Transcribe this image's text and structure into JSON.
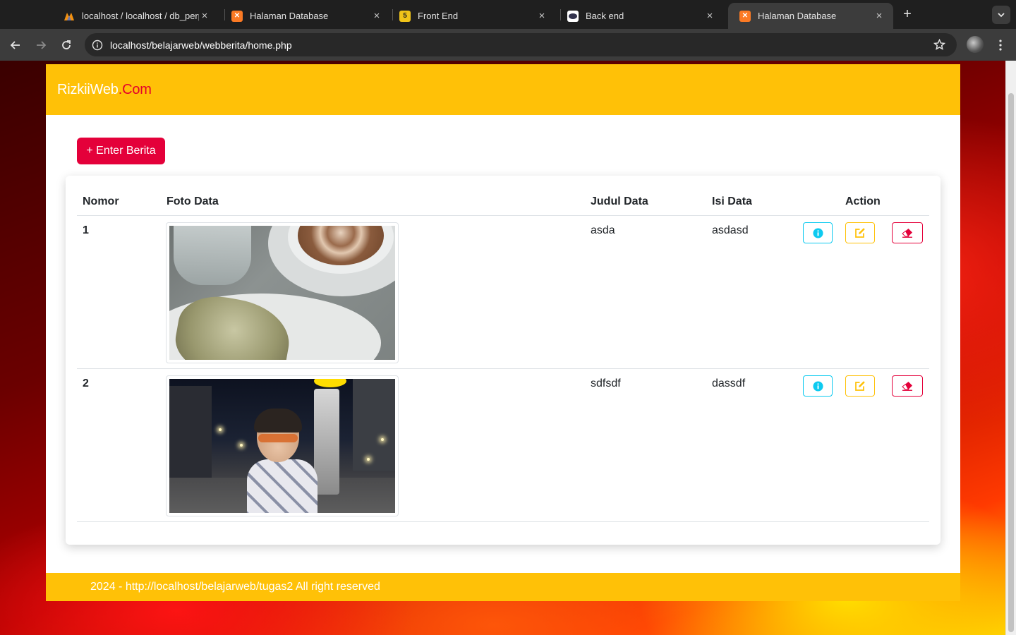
{
  "browser": {
    "tabs": [
      {
        "title": "localhost / localhost / db_perp",
        "favicon": "phpmyadmin-icon",
        "active": false
      },
      {
        "title": "Halaman Database",
        "favicon": "xampp-icon",
        "active": false
      },
      {
        "title": "Front End",
        "favicon": "html5-icon",
        "active": false
      },
      {
        "title": "Back end",
        "favicon": "generic-icon",
        "active": false
      },
      {
        "title": "Halaman Database",
        "favicon": "xampp-icon",
        "active": true
      }
    ],
    "url": "localhost/belajarweb/webberita/home.php"
  },
  "site": {
    "brand_main": "RizkiiWeb",
    "brand_accent": ".Com",
    "add_button": "+ Enter Berita",
    "footer": "2024 - http://localhost/belajarweb/tugas2 All right reserved"
  },
  "table": {
    "headers": {
      "nomor": "Nomor",
      "foto": "Foto Data",
      "judul": "Judul Data",
      "isi": "Isi Data",
      "action": "Action"
    },
    "rows": [
      {
        "nomor": "1",
        "judul": "asda",
        "isi": "asdasd",
        "photo": "coffee-and-pastry-photo"
      },
      {
        "nomor": "2",
        "judul": "sdfsdf",
        "isi": "dassdf",
        "photo": "night-street-portrait-photo"
      }
    ]
  },
  "colors": {
    "header_bg": "#ffc107",
    "brand_accent": "#e4002b",
    "primary_button": "#e4003a",
    "info_outline": "#0dcaf0",
    "edit_outline": "#ffc107",
    "delete_outline": "#e4003a"
  }
}
